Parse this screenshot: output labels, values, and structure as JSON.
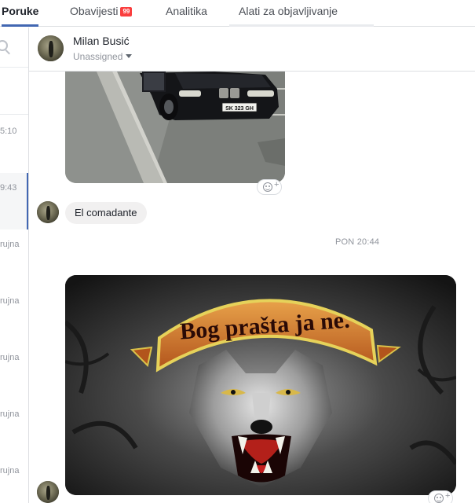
{
  "tabs": {
    "messages": "Poruke",
    "notifications": "Obavijesti",
    "notifications_badge": "99",
    "insights": "Analitika",
    "publishing_tools": "Alati za objavljivanje"
  },
  "conversation_list": {
    "items": [
      {
        "time": "5:10"
      },
      {
        "time": "9:43"
      },
      {
        "time": "rujna"
      },
      {
        "time": "rujna"
      },
      {
        "time": "rujna"
      },
      {
        "time": "rujna"
      },
      {
        "time": "rujna"
      }
    ]
  },
  "conversation": {
    "contact_name": "Milan Busić",
    "assignment": "Unassigned"
  },
  "messages": {
    "text_message": "El comadante",
    "timestamp": "PON 20:44",
    "photo2_caption": "Bog prašta ja ne."
  },
  "colors": {
    "accent": "#4267b2",
    "badge": "#fa3e3e",
    "bubble_bg": "#f1f0f0",
    "muted_text": "#90949c"
  },
  "icons": {
    "search": "search-icon",
    "caret": "chevron-down-icon",
    "react": "add-reaction-icon"
  }
}
